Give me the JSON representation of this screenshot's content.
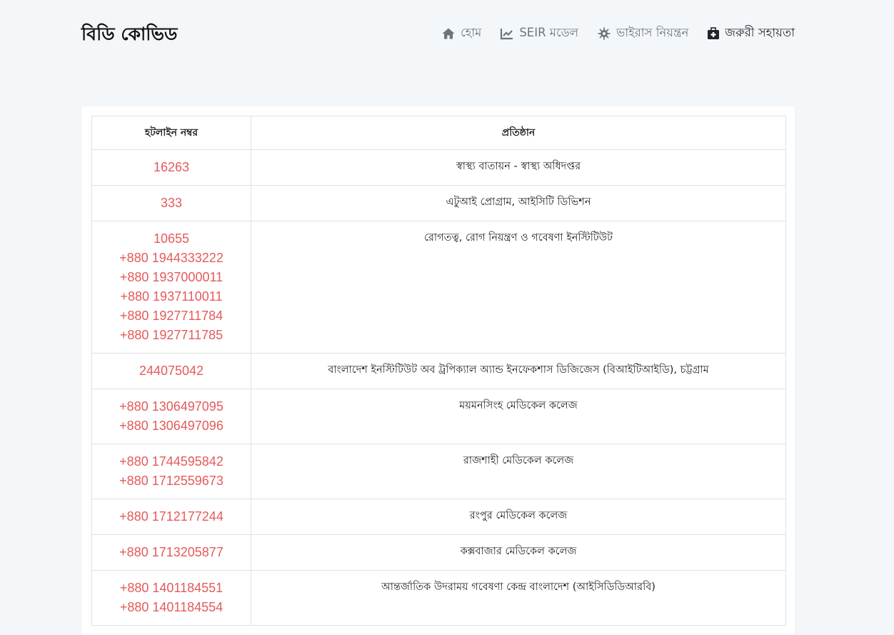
{
  "brand": "বিডি কোভিড",
  "nav": [
    {
      "label": "হোম",
      "icon": "home-icon"
    },
    {
      "label": "SEIR মডেল",
      "icon": "chart-line-icon"
    },
    {
      "label": "ভাইরাস নিয়ন্ত্রন",
      "icon": "virus-icon"
    },
    {
      "label": "জরুরী সহায়তা",
      "icon": "medkit-icon"
    }
  ],
  "table": {
    "headers": [
      "হটলাইন নম্বর",
      "প্রতিষ্ঠান"
    ],
    "rows": [
      {
        "numbers": [
          "16263"
        ],
        "org": "স্বাস্থ্য বাতায়ন - স্বাস্থ্য অধিদপ্তর"
      },
      {
        "numbers": [
          "333"
        ],
        "org": "এটুআই প্রোগ্রাম, আইসিটি ডিভিশন"
      },
      {
        "numbers": [
          "10655",
          "+880 1944333222",
          "+880 1937000011",
          "+880 1937110011",
          "+880 1927711784",
          "+880 1927711785"
        ],
        "org": "রোগতত্ব, রোগ নিয়ন্ত্রণ ও গবেষণা ইনস্টিটিউট"
      },
      {
        "numbers": [
          "244075042"
        ],
        "org": "বাংলাদেশ ইনস্টিটিউট অব ট্রপিক্যাল অ্যান্ড ইনফেকশাস ডিজিজেস (বিআইটিআইডি), চট্টগ্রাম"
      },
      {
        "numbers": [
          "+880 1306497095",
          "+880 1306497096"
        ],
        "org": "ময়মনসিংহ মেডিকেল কলেজ"
      },
      {
        "numbers": [
          "+880 1744595842",
          "+880 1712559673"
        ],
        "org": "রাজশাহী মেডিকেল কলেজ"
      },
      {
        "numbers": [
          "+880 1712177244"
        ],
        "org": "রংপুর মেডিকেল কলেজ"
      },
      {
        "numbers": [
          "+880 1713205877"
        ],
        "org": "কক্সবাজার মেডিকেল কলেজ"
      },
      {
        "numbers": [
          "+880 1401184551",
          "+880 1401184554"
        ],
        "org": "আন্তর্জাতিক উদরাময় গবেষণা কেন্দ্র বাংলাদেশ (আইসিডিডিআরবি)"
      }
    ]
  },
  "colors": {
    "background": "#f4f7fa",
    "phone": "#e45a5a",
    "nav_inactive": "#6c757d",
    "nav_active": "#212529"
  }
}
